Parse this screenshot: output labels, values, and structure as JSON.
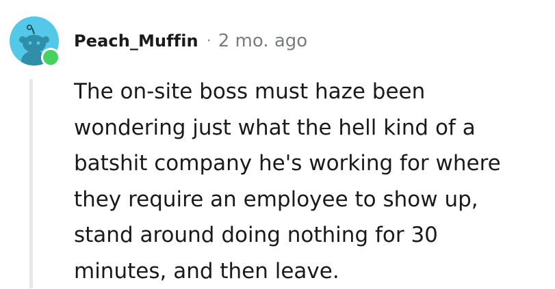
{
  "comment": {
    "author": "Peach_Muffin",
    "separator": "·",
    "age": "2 mo. ago",
    "avatar_icon": "reddit-snoo-avatar-icon",
    "status_icon": "online-status-icon",
    "status_color": "#46d160",
    "avatar_color": "#54c8e8",
    "body": "The on-site boss must haze been\nwondering just what the hell kind of a\nbatshit company he's working for where\nthey require an employee to show up,\nstand around doing nothing for 30\nminutes, and then leave."
  }
}
